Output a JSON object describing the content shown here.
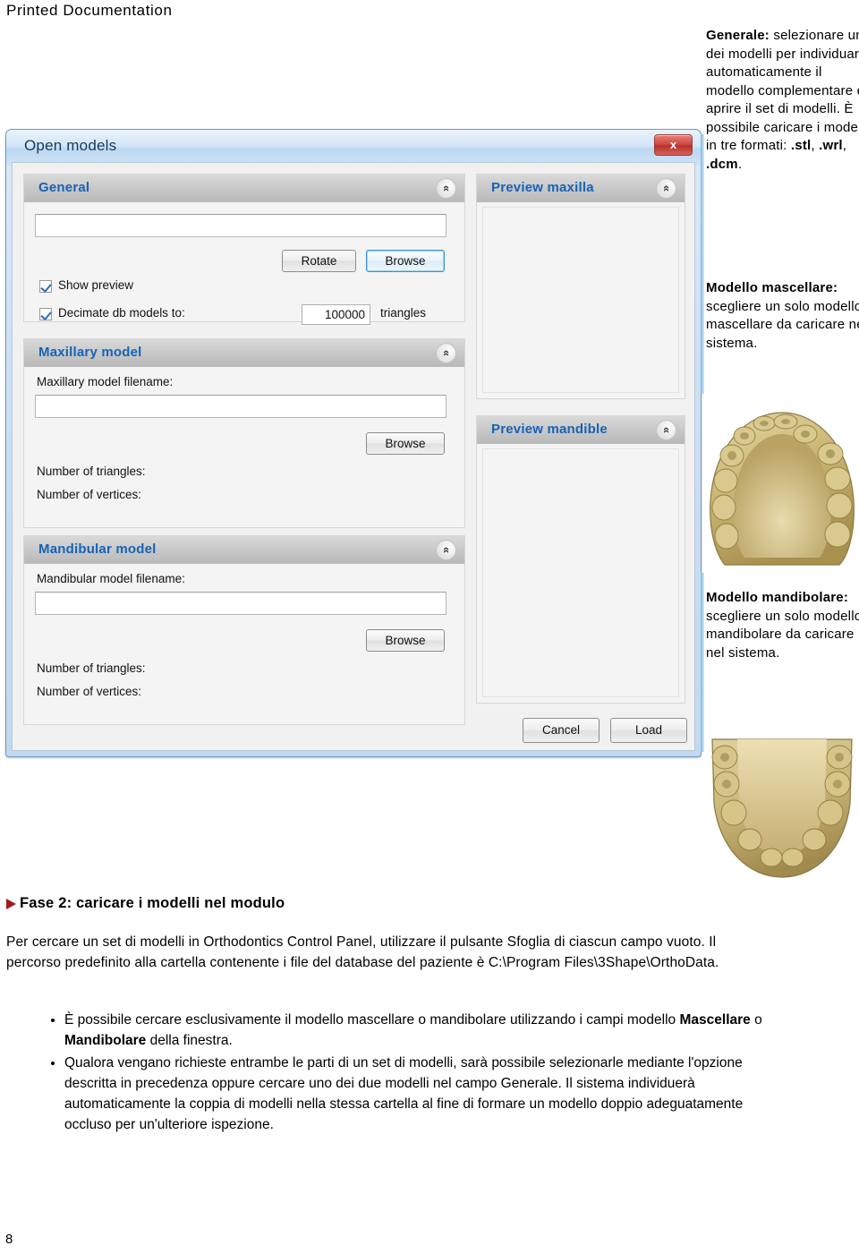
{
  "document": {
    "header": "Printed Documentation",
    "page_number": "8"
  },
  "dialog": {
    "title": "Open models",
    "close_label": "x",
    "collapse_icon": "«",
    "groups": {
      "general": {
        "title": "General",
        "path_value": "",
        "rotate_button": "Rotate",
        "browse_button": "Browse",
        "show_preview_label": "Show preview",
        "show_preview_checked": true,
        "decimate_label": "Decimate db models to:",
        "decimate_checked": true,
        "decimate_value": "100000",
        "decimate_unit": "triangles"
      },
      "maxillary": {
        "title": "Maxillary model",
        "filename_label": "Maxillary model filename:",
        "filename_value": "",
        "browse_button": "Browse",
        "triangles_label": "Number of triangles:",
        "vertices_label": "Number of vertices:"
      },
      "mandibular": {
        "title": "Mandibular model",
        "filename_label": "Mandibular model filename:",
        "filename_value": "",
        "browse_button": "Browse",
        "triangles_label": "Number of triangles:",
        "vertices_label": "Number of vertices:"
      },
      "preview_maxilla": {
        "title": "Preview maxilla"
      },
      "preview_mandible": {
        "title": "Preview mandible"
      }
    },
    "footer": {
      "cancel_button": "Cancel",
      "load_button": "Load"
    }
  },
  "annotations": {
    "general": {
      "term": "Generale:",
      "text": " selezionare uno dei modelli per individuare automaticamente il modello complementare e aprire il set di modelli. È possibile caricare i modelli in tre formati: ",
      "f1": ".stl",
      "sep1": ", ",
      "f2": ".wrl",
      "sep2": ", ",
      "f3": ".dcm",
      "end": "."
    },
    "maxillary": {
      "term": "Modello mascellare:",
      "text": " scegliere un solo modello mascellare da caricare nel sistema."
    },
    "mandibular": {
      "term": "Modello mandibolare:",
      "text": " scegliere un solo modello mandibolare da caricare nel sistema."
    }
  },
  "body": {
    "step_heading": "Fase 2: caricare i modelli nel modulo",
    "intro": "Per cercare un set di modelli in Orthodontics Control Panel, utilizzare il pulsante Sfoglia di ciascun campo vuoto. Il percorso predefinito alla cartella contenente i file del database del paziente è C:\\Program Files\\3Shape\\OrthoData.",
    "bullets": [
      {
        "pre": "È possibile cercare esclusivamente il modello mascellare o mandibolare utilizzando i campi modello ",
        "b1": "Mascellare",
        "mid": " o ",
        "b2": "Mandibolare",
        "post": " della finestra."
      },
      {
        "pre": "Qualora vengano richieste entrambe le parti di un set di modelli, sarà possibile selezionarle mediante l'opzione descritta in precedenza oppure cercare uno dei due modelli nel campo Generale. Il sistema individuerà automaticamente la coppia di modelli nella stessa cartella al fine di formare un modello doppio adeguatamente occluso per un'ulteriore ispezione.",
        "b1": "",
        "mid": "",
        "b2": "",
        "post": ""
      }
    ]
  },
  "colors": {
    "accent_blue": "#1763b5",
    "title_bar": "#bcd8f1",
    "close_red": "#cf4a42",
    "step_arrow_red": "#9e1b20",
    "tooth_gold": "#c8b273"
  }
}
